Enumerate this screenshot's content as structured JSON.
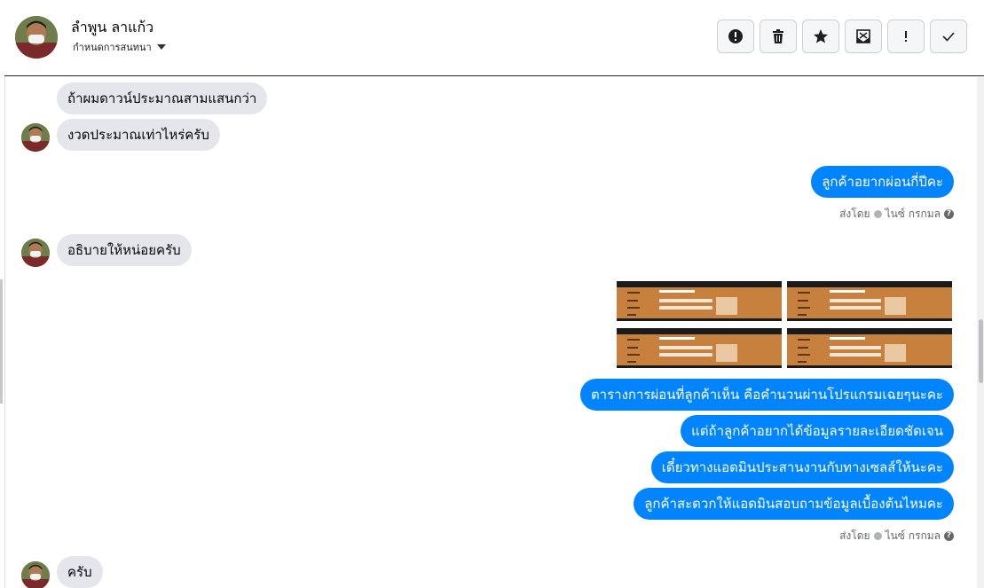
{
  "header": {
    "contact_name": "ลำพูน ลาแก้ว",
    "subtitle": "กำหนดการสนทนา",
    "actions": [
      {
        "icon": "alert-circle-icon",
        "name": "report-button"
      },
      {
        "icon": "trash-icon",
        "name": "delete-button"
      },
      {
        "icon": "star-icon",
        "name": "star-button"
      },
      {
        "icon": "mark-unread-icon",
        "name": "mark-unread-button"
      },
      {
        "icon": "exclamation-icon",
        "name": "spam-button"
      },
      {
        "icon": "check-icon",
        "name": "done-button"
      }
    ]
  },
  "messages": {
    "in_1": "ถ้าผมดาวน์ประมาณสามแสนกว่า",
    "in_2": "งวดประมาณเท่าไหร่ครับ",
    "out_1": "ลูกค้าอยากผ่อนกี่ปีคะ",
    "in_3": "อธิบายให้หน่อยครับ",
    "out_2": "ตารางการผ่อนที่ลูกค้าเห็น คือคำนวนผ่านโปรแกรมเฉยๆนะคะ",
    "out_3": "แต่ถ้าลูกค้าอยากได้ข้อมูลรายละเอียดชัดเจน",
    "out_4": "เดี๋ยวทางแอดมินประสานงานกับทางเซลส์ให้นะคะ",
    "out_5": "ลูกค้าสะดวกให้แอดมินสอบถามข้อมูลเบื้องต้นไหมคะ",
    "in_4": "ครับ"
  },
  "sent_by": {
    "prefix": "ส่งโดย",
    "agent": "ไนซ์ กรกมล",
    "help": "?"
  },
  "colors": {
    "outgoing_bubble": "#0084ff",
    "incoming_bubble": "#e4e6eb",
    "attachment": "#c7803e"
  },
  "attachments_count_label": ""
}
